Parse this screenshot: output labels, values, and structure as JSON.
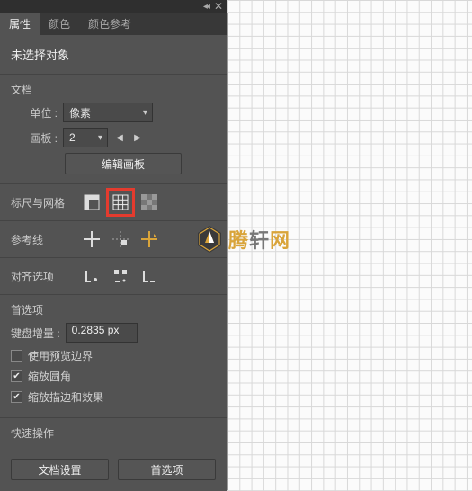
{
  "panel": {
    "tabs": [
      "属性",
      "颜色",
      "颜色参考"
    ],
    "active_tab": 0,
    "no_selection": "未选择对象"
  },
  "document": {
    "title": "文档",
    "unit_label": "单位 :",
    "unit_value": "像素",
    "artboard_label": "画板 :",
    "artboard_value": "2",
    "edit_artboards": "编辑画板"
  },
  "rulers_grid": {
    "title": "标尺与网格"
  },
  "guides": {
    "title": "参考线"
  },
  "snap": {
    "title": "对齐选项"
  },
  "preferences": {
    "title": "首选项",
    "keyboard_increment_label": "键盘增量 :",
    "keyboard_increment_value": "0.2835 px",
    "use_preview_bounds": "使用预览边界",
    "use_preview_bounds_checked": false,
    "scale_corners": "缩放圆角",
    "scale_corners_checked": true,
    "scale_strokes": "缩放描边和效果",
    "scale_strokes_checked": true
  },
  "quick_actions": {
    "title": "快速操作",
    "document_setup": "文档设置",
    "preferences": "首选项"
  },
  "watermark": {
    "text": "腾轩网"
  },
  "colors": {
    "highlight": "#e43b2e"
  }
}
